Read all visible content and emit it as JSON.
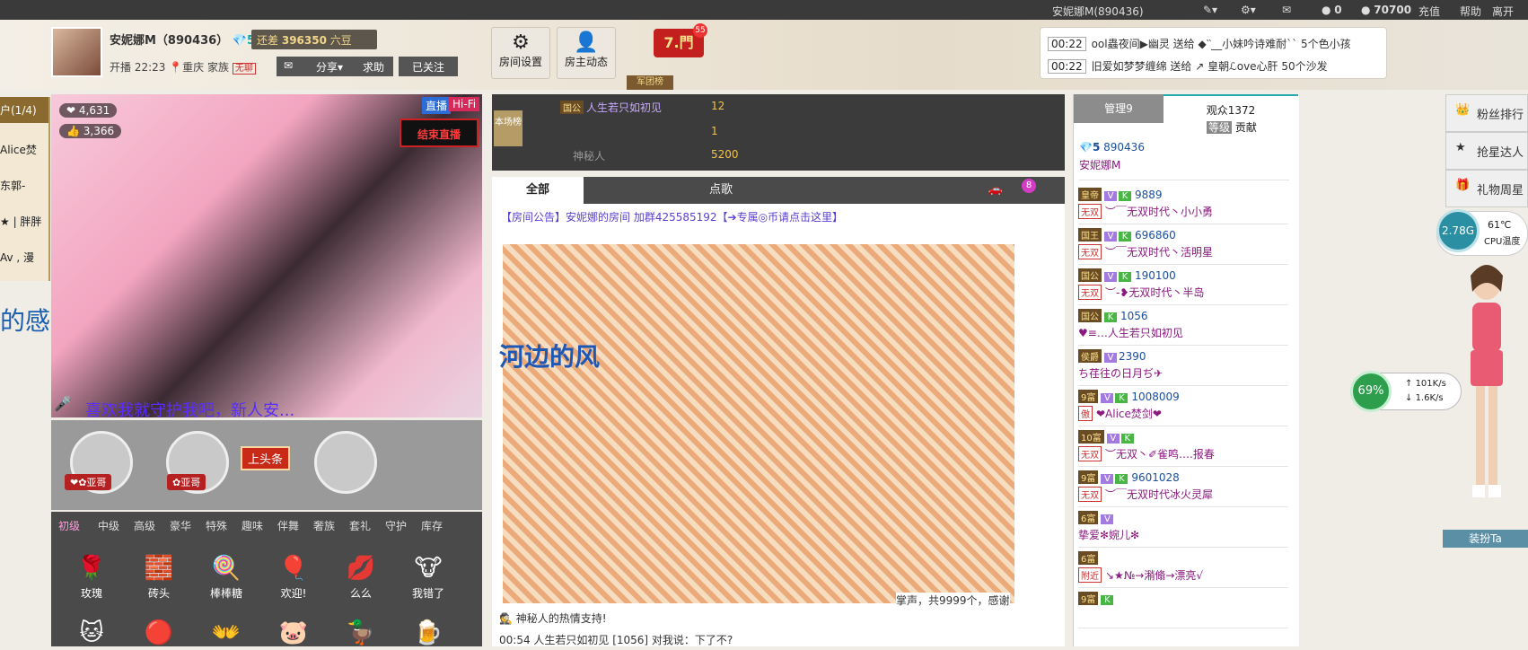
{
  "topbar": {
    "user": "安妮娜M(890436)",
    "gold": "0",
    "beans": "70700",
    "recharge": "充值",
    "help": "帮助",
    "leave": "离开"
  },
  "host": {
    "name": "安妮娜M（890436）",
    "level": "5",
    "gap_label": "还差",
    "gap_value": "396350",
    "gap_unit": "六豆",
    "start_label": "开播 22:23",
    "location": "重庆",
    "family_label": "家族",
    "family_value": "无聊",
    "share": "分享",
    "help": "求助",
    "followed": "已关注"
  },
  "tools": {
    "settings": "房间设置",
    "host_news": "房主动态",
    "badge": "7.門",
    "badge_count": "55",
    "army": "军团榜"
  },
  "gift_feed": [
    {
      "time": "00:22",
      "text": "ool蟲夜间▶幽灵 送给 ◆‵‵__小妹吟诗难耐`` 5个色小孩"
    },
    {
      "time": "00:22",
      "text": "旧爱如梦梦缠绵 送给 ↗ 皇朝ℒove心肝 50个沙发"
    }
  ],
  "left_strip": {
    "title": "户(1/4)",
    "items": [
      "Alice焚",
      "东郭-",
      "★ | 胖胖",
      "Av , 漫"
    ],
    "caption": "的感受"
  },
  "video": {
    "hot": "4,631",
    "fans": "3,366",
    "live": "直播",
    "hifi": "Hi-Fi",
    "end": "结束直播",
    "caption": "喜欢我就守护我吧，新人安...",
    "sign": "上头条",
    "guard1": "❤✿亚哥",
    "guard2": "✿亚哥"
  },
  "gift_tabs": [
    "初级",
    "中级",
    "高级",
    "豪华",
    "特殊",
    "趣味",
    "伴舞",
    "奢族",
    "套礼",
    "守护",
    "库存"
  ],
  "gifts": [
    {
      "icon": "🌹",
      "name": "玫瑰"
    },
    {
      "icon": "🧱",
      "name": "砖头"
    },
    {
      "icon": "🍭",
      "name": "棒棒糖"
    },
    {
      "icon": "🎈",
      "name": "欢迎!"
    },
    {
      "icon": "💋",
      "name": "么么"
    },
    {
      "icon": "🐮",
      "name": "我错了"
    },
    {
      "icon": "🐱",
      "name": ""
    },
    {
      "icon": "🔴",
      "name": ""
    },
    {
      "icon": "👐",
      "name": ""
    },
    {
      "icon": "🐷",
      "name": ""
    },
    {
      "icon": "🦆",
      "name": ""
    },
    {
      "icon": "🍺",
      "name": ""
    }
  ],
  "rank": {
    "label": "本场榜",
    "rows": [
      {
        "tag": "国公",
        "name": "人生若只如初见",
        "value": "12"
      },
      {
        "tag": "",
        "name": "",
        "value": "1"
      },
      {
        "tag": "",
        "name": "神秘人",
        "value": "5200"
      }
    ]
  },
  "chat_tabs": [
    "全部",
    "",
    "点歌",
    "",
    "",
    ""
  ],
  "chat_tab_badge": "8",
  "chat": {
    "notice": "【房间公告】安妮娜的房间  加群425585192【➔专属◎币请点击这里】",
    "overlay": "河边的风",
    "applause": "掌声，共9999个，感谢",
    "thanks": "神秘人的热情支持!",
    "last_line": "00:54  人生若只如初见 [1056] 对我说：下了不?"
  },
  "audience": {
    "manage_tab": "管理9",
    "audience_tab": "观众1372",
    "level_label": "等级",
    "contrib_label": "贡献",
    "host_level": "5",
    "host_id": "890436",
    "host_name": "安妮娜M",
    "users": [
      {
        "lvl": "皇帝",
        "v": "V",
        "k": "K",
        "id": "9889",
        "tag": "无双",
        "name": "︶￣无双时代丶小小勇"
      },
      {
        "lvl": "国王",
        "v": "V",
        "k": "K",
        "id": "696860",
        "tag": "无双",
        "name": "︶￣无双时代丶活明星"
      },
      {
        "lvl": "国公",
        "v": "V",
        "k": "K",
        "id": "190100",
        "tag": "无双",
        "name": "︶-❥无双时代丶半岛"
      },
      {
        "lvl": "国公",
        "v": "",
        "k": "K",
        "id": "1056",
        "tag": "",
        "name": "♥≡…人生若只如初见"
      },
      {
        "lvl": "侯爵",
        "v": "V",
        "k": "",
        "id": "2390",
        "tag": "",
        "name": "ち荏往の日月ぢ✈"
      },
      {
        "lvl": "9富",
        "v": "V",
        "k": "K",
        "id": "1008009",
        "tag": "傲",
        "name": "❤Alice焚剑❤"
      },
      {
        "lvl": "10富",
        "v": "V",
        "k": "K",
        "id": "",
        "tag": "无双",
        "name": "︶无双丶✐雀鸣….报春"
      },
      {
        "lvl": "9富",
        "v": "V",
        "k": "K",
        "id": "9601028",
        "tag": "无双",
        "name": "︶￣无双时代冰火灵犀"
      },
      {
        "lvl": "6富",
        "v": "V",
        "k": "",
        "id": "",
        "tag": "",
        "name": "挚爱✻婉儿✻"
      },
      {
        "lvl": "6富",
        "v": "",
        "k": "",
        "id": "",
        "tag": "附近",
        "name": "↘★№→潲翛→漂亮√"
      },
      {
        "lvl": "9富",
        "v": "",
        "k": "K",
        "id": "",
        "tag": "",
        "name": ""
      }
    ]
  },
  "side": {
    "fans_rank": "粉丝排行",
    "star": "抢星达人",
    "gift_week": "礼物周星",
    "mem": "2.78G",
    "temp": "61℃",
    "temp_label": "CPU温度",
    "net_pct": "69%",
    "up": "101K/s",
    "down": "1.6K/s",
    "dress": "装扮Ta"
  },
  "colors": {
    "topbar": "#3a3a3a",
    "chat_tab": "#4a4a4a",
    "accent_red": "#c33"
  }
}
